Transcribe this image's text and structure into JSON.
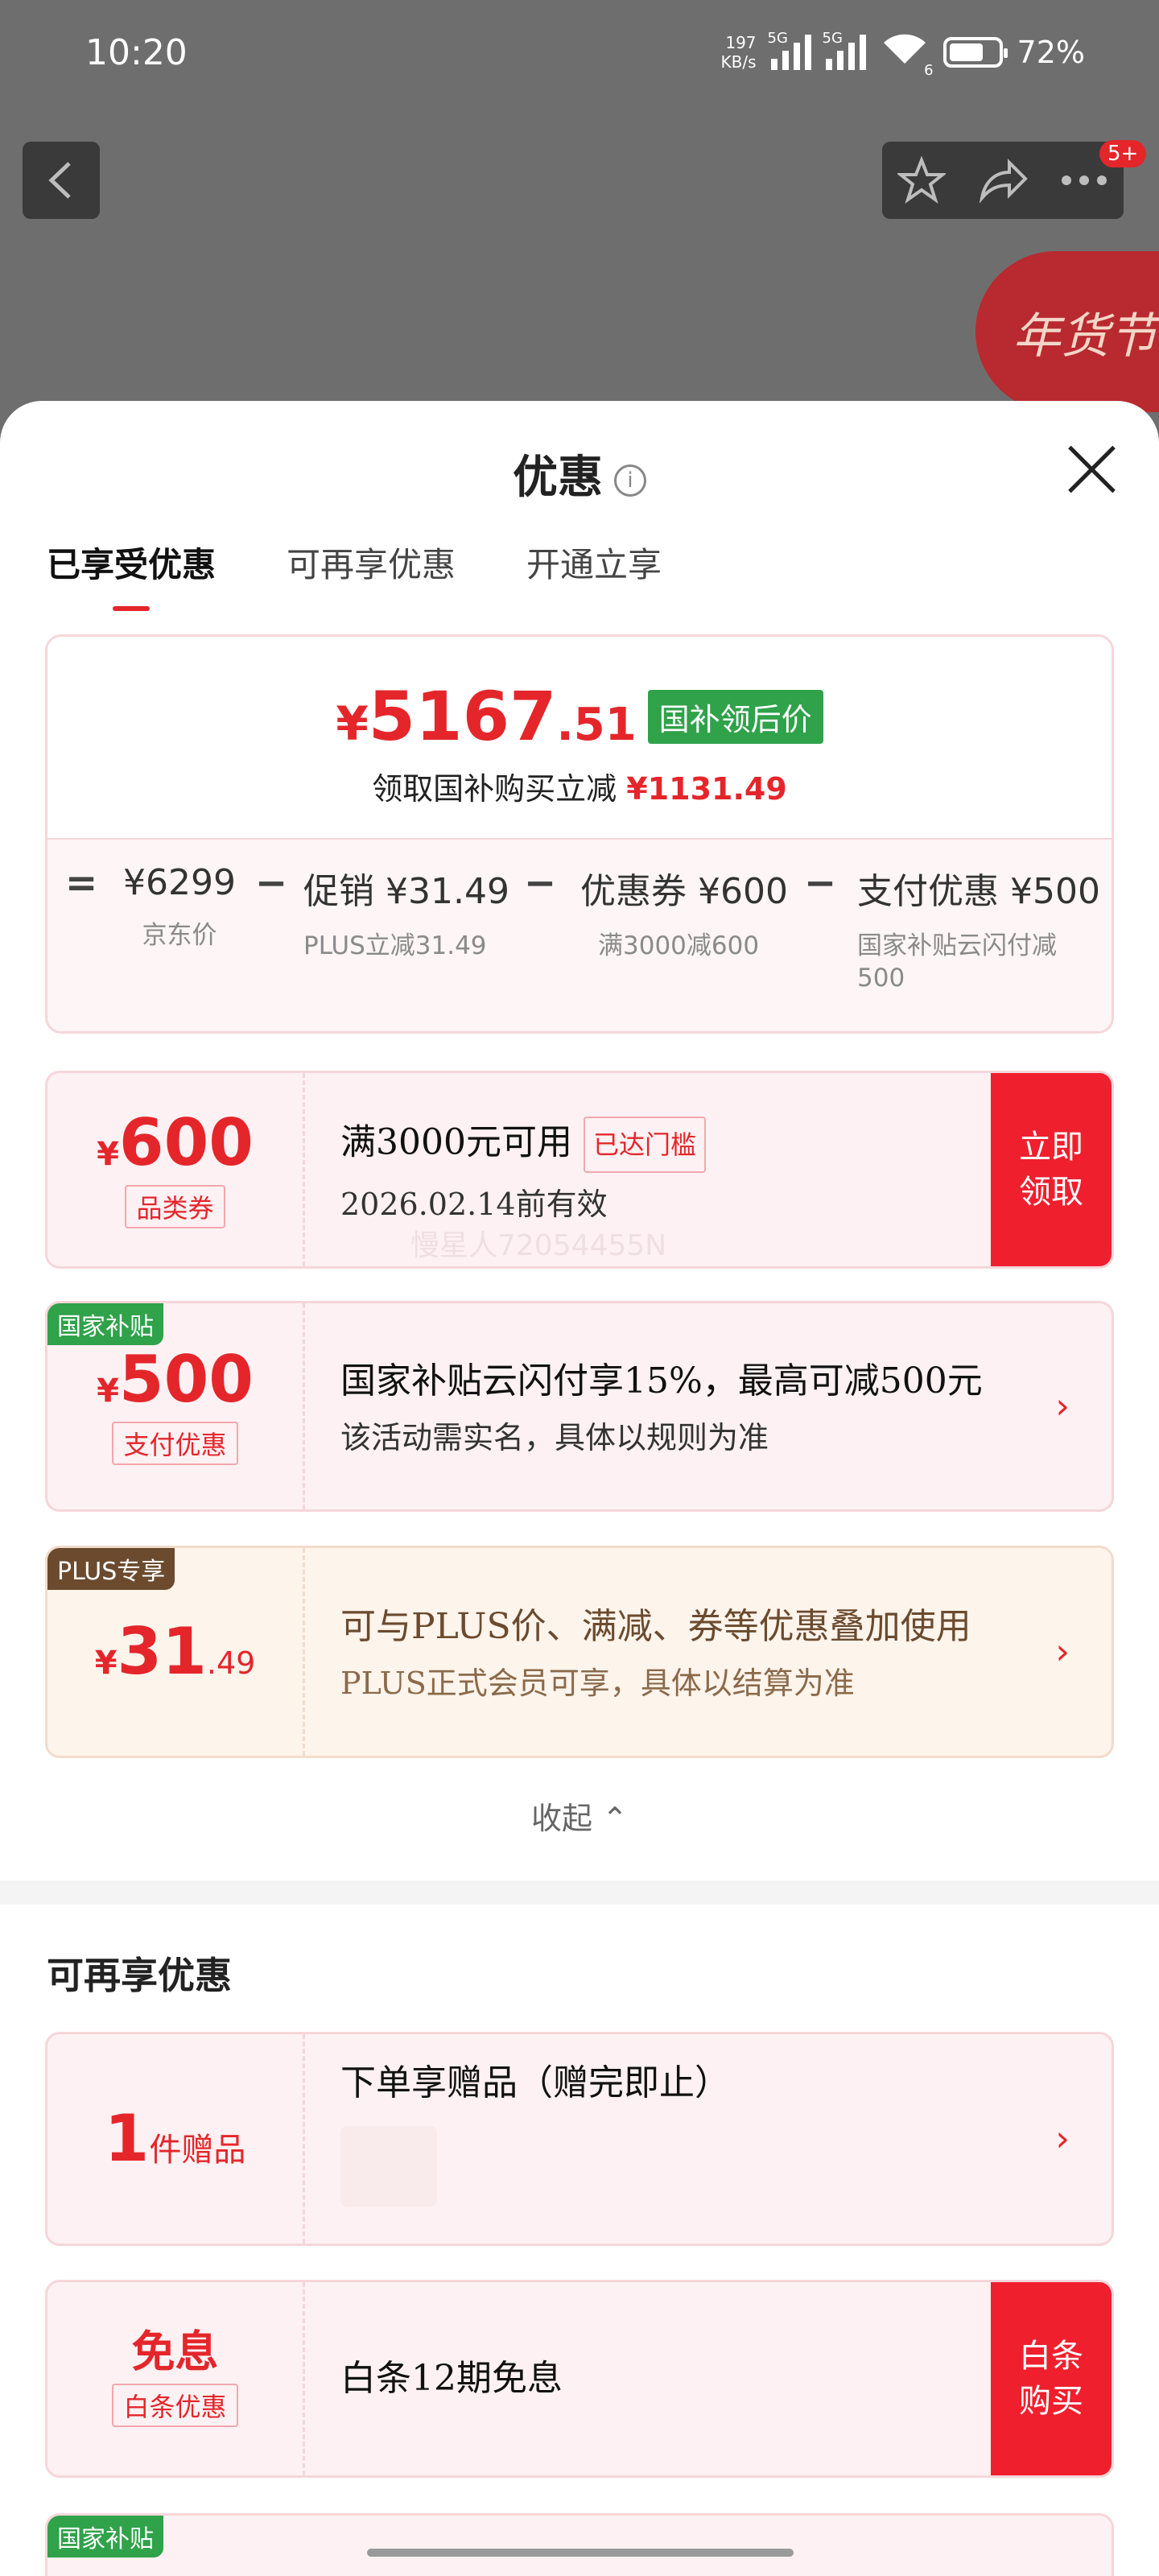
{
  "status_bar": {
    "time": "10:20",
    "net_speed_value": "197",
    "net_speed_unit": "KB/s",
    "network_1": "5G",
    "network_2": "5G",
    "wifi_index": "6",
    "battery": "72%",
    "battery_level": 0.72
  },
  "top_nav": {
    "back_icon": "chevron-left",
    "favorite_icon": "star",
    "share_icon": "share",
    "more_icon": "more",
    "message_badge": "5+",
    "festival_badge": "年货节"
  },
  "sheet": {
    "title": "优惠",
    "info_icon": "i",
    "tabs": [
      {
        "label": "已享受优惠",
        "active": true
      },
      {
        "label": "可再享优惠",
        "active": false
      },
      {
        "label": "开通立享",
        "active": false
      }
    ],
    "summary": {
      "currency": "¥",
      "price_int": "5167",
      "price_dec": ".51",
      "price_tag": "国补领后价",
      "subtitle": "领取国补购买立减",
      "saving": "¥1131.49",
      "calc": [
        {
          "op": "=",
          "main": "¥6299",
          "sub": "京东价"
        },
        {
          "op": "−",
          "main": "促销 ¥31.49",
          "sub": "PLUS立减31.49"
        },
        {
          "op": "−",
          "main": "优惠券 ¥600",
          "sub": "满3000减600"
        },
        {
          "op": "−",
          "main": "支付优惠 ¥500",
          "sub": "国家补贴云闪付减500"
        }
      ]
    },
    "coupons": [
      {
        "currency": "¥",
        "amount": "600",
        "type": "品类券",
        "title": "满3000元可用",
        "threshold_tag": "已达门槛",
        "desc": "2026.02.14前有效",
        "action": "立即领取"
      },
      {
        "corner": "国家补贴",
        "currency": "¥",
        "amount": "500",
        "type": "支付优惠",
        "title": "国家补贴云闪付享15%，最高可减500元",
        "desc": "该活动需实名，具体以规则为准"
      },
      {
        "corner": "PLUS专享",
        "currency": "¥",
        "amount": "31",
        "amount_dec": ".49",
        "title": "可与PLUS价、满减、券等优惠叠加使用",
        "desc": "PLUS正式会员可享，具体以结算为准"
      }
    ],
    "watermark": "慢星人72054455N",
    "collapse_label": "收起",
    "more_section": {
      "title": "可再享优惠",
      "items": [
        {
          "amount": "1",
          "unit": "件赠品",
          "title": "下单享赠品（赠完即止）"
        },
        {
          "amount": "免息",
          "type": "白条优惠",
          "title": "白条12期免息",
          "action": "白条购买"
        }
      ],
      "partial_corner": "国家补贴"
    }
  },
  "colors": {
    "accent_red": "#e4262b",
    "button_red": "#f01f2e",
    "gov_green": "#2fa24a",
    "plus_brown": "#6b4a2e"
  }
}
